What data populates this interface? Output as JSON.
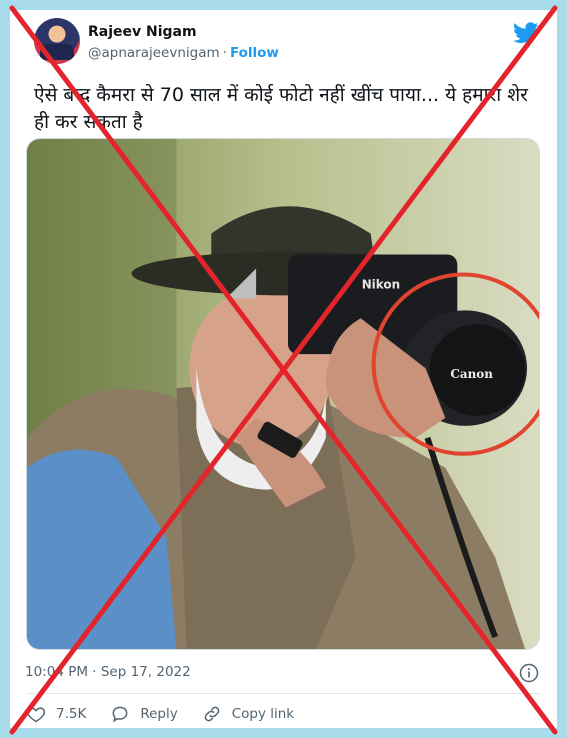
{
  "colors": {
    "background": "#a8dcec",
    "accent": "#1d9bf0",
    "fact_check_cross": "#e4242b",
    "highlight_circle": "#e0442e"
  },
  "author": {
    "display_name": "Rajeev Nigam",
    "handle": "@apnarajeevnigam",
    "separator": "·",
    "follow_label": "Follow"
  },
  "tweet": {
    "text": "ऐसे बन्द कैमरा से 70 साल में कोई फोटो नहीं खींच पाया... ये हमारा शेर ही कर सकता है",
    "timestamp": "10:04 PM · Sep 17, 2022"
  },
  "media": {
    "camera_brand_text": "Canon",
    "camera_body_text": "Nikon"
  },
  "actions": {
    "like_count": "7.5K",
    "reply_label": "Reply",
    "copy_link_label": "Copy link"
  },
  "icons": {
    "logo": "twitter-bird-icon",
    "info": "info-icon",
    "like": "heart-icon",
    "reply": "reply-bubble-icon",
    "copy": "link-icon"
  }
}
